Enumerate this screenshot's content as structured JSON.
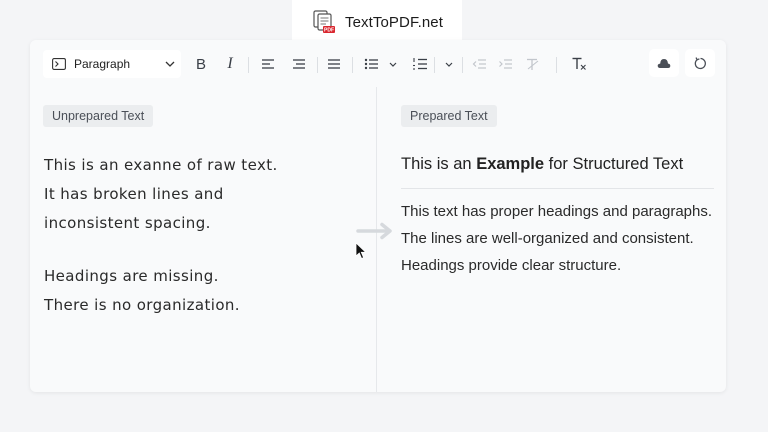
{
  "logo": {
    "name": "TextToPDF.net",
    "icon": "document-pdf-icon",
    "badge": "PDF"
  },
  "toolbar": {
    "paragraph_style": "Paragraph",
    "icons": [
      "paragraph-style-icon",
      "bold-icon",
      "italic-icon",
      "align-left-icon",
      "align-center-icon",
      "align-justify-icon",
      "bulleted-list-icon",
      "numbered-list-icon",
      "outdent-icon",
      "indent-icon",
      "remove-format-icon",
      "clear-formatting-icon",
      "cloud-icon",
      "refresh-icon"
    ],
    "bold": "B",
    "italic": "I"
  },
  "left_pane": {
    "tag": "Unprepared Text",
    "lines": [
      "This is an exanne of raw text.",
      "It has broken lines and",
      "inconsistent spacing.",
      "Headings are missing.",
      "There is no organization."
    ]
  },
  "right_pane": {
    "tag": "Prepared Text",
    "heading_pre": "This is an ",
    "heading_bold": "Example",
    "heading_post": " for Structured Text",
    "body": "This text has proper headings and paragraphs. The lines are well-organized and consistent. Headings provide clear structure."
  },
  "colors": {
    "accent_arrow": "#d6d9dd",
    "text": "#222222",
    "tag_bg": "#ebedef"
  }
}
